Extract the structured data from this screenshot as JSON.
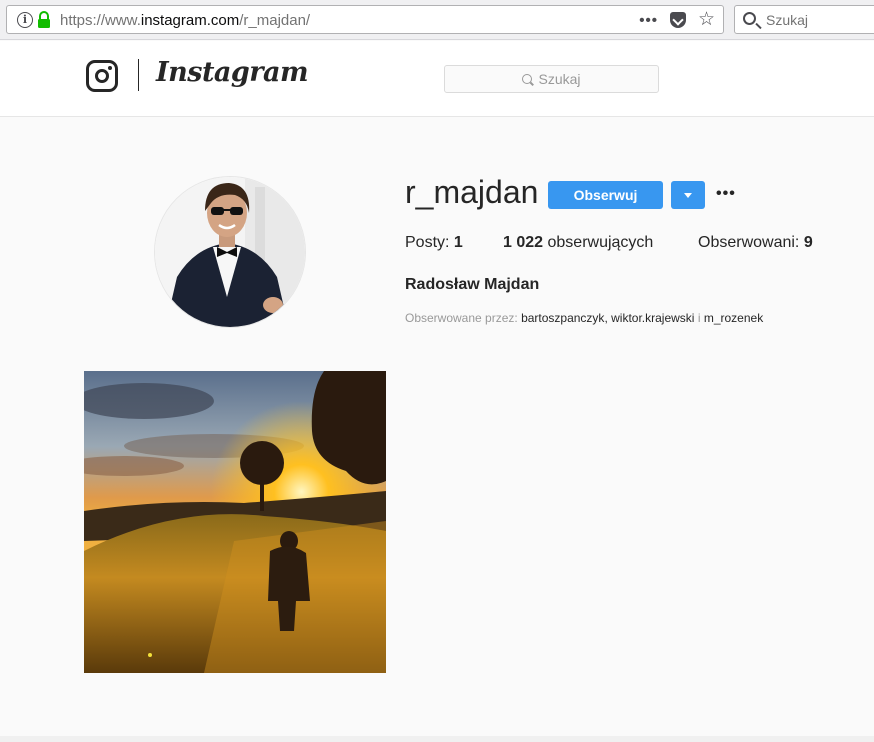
{
  "browser": {
    "url_prefix": "https://www.",
    "url_host": "instagram.com",
    "url_path": "/r_majdan/",
    "search_placeholder": "Szukaj",
    "page_actions_label": "•••"
  },
  "header": {
    "wordmark": "Instagram",
    "search_placeholder": "Szukaj"
  },
  "profile": {
    "username": "r_majdan",
    "follow_label": "Obserwuj",
    "more_label": "•••",
    "stats": {
      "posts_label": "Posty:",
      "posts_value": "1",
      "followers_value": "1 022",
      "followers_label": "obserwujących",
      "following_label": "Obserwowani:",
      "following_value": "9"
    },
    "full_name": "Radosław Majdan",
    "followed_by": {
      "prefix": "Obserwowane przez:",
      "user1": "bartoszpanczyk",
      "sep1": ",",
      "user2": "wiktor.krajewski",
      "sep2": "i",
      "user3": "m_rozenek"
    }
  },
  "posts_count": 1,
  "colors": {
    "accent": "#3897f0",
    "text": "#262626",
    "muted": "#999999",
    "background": "#fafafa"
  },
  "icons": [
    "info-icon",
    "lock-icon",
    "more-dots-icon",
    "pocket-icon",
    "bookmark-star-icon",
    "search-icon",
    "camera-icon",
    "chevron-down-icon"
  ]
}
